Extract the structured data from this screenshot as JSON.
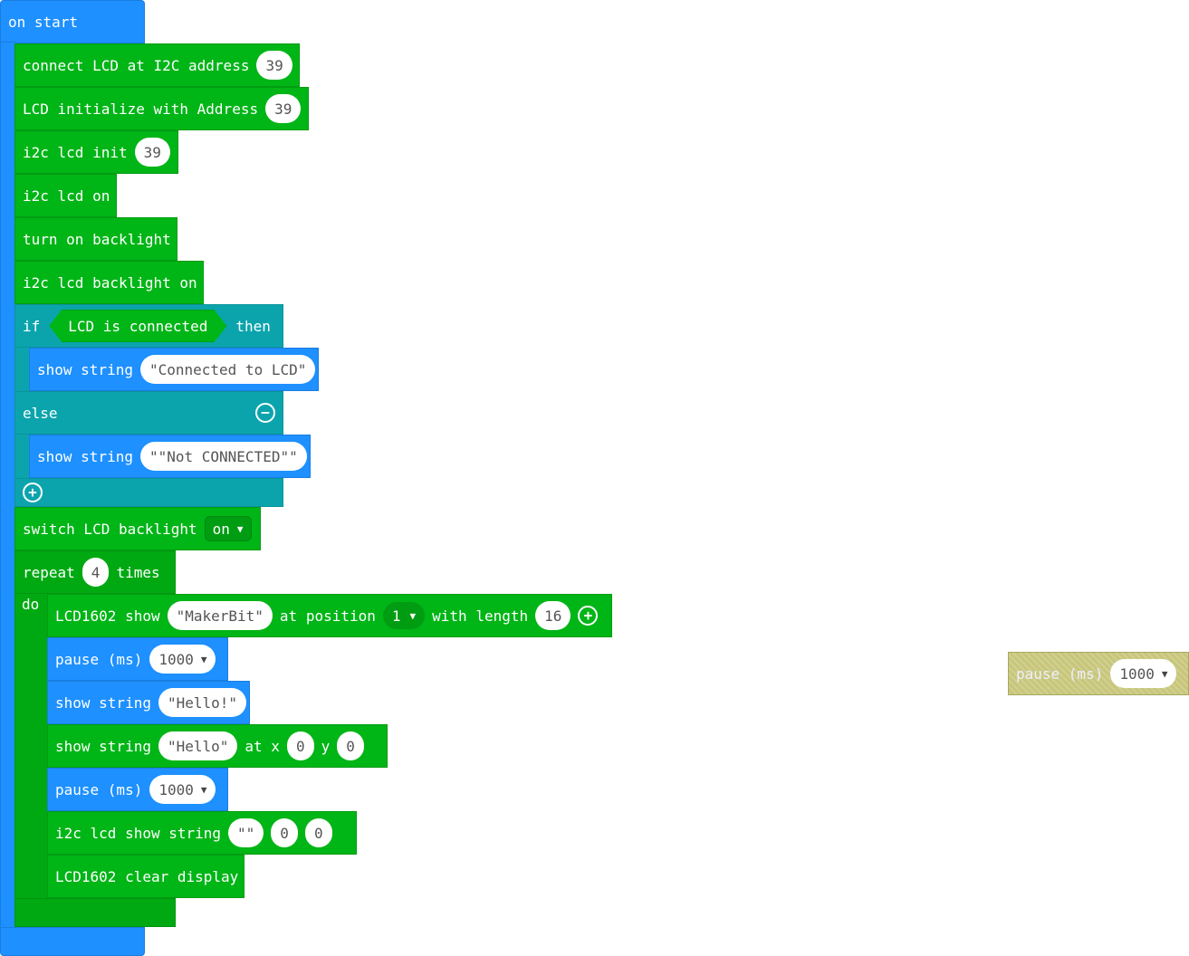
{
  "colors": {
    "event": "#1e90ff",
    "lcd": "#00b516",
    "logic": "#0ba4ad",
    "loop": "#00a912",
    "disabled": "#c7c67a"
  },
  "on_start": {
    "label": "on start"
  },
  "connect_lcd": {
    "label": "connect LCD at I2C address",
    "value": "39"
  },
  "lcd_init": {
    "label": "LCD initialize with Address",
    "value": "39"
  },
  "i2c_init": {
    "label": "i2c lcd init",
    "value": "39"
  },
  "i2c_on": {
    "label": "i2c lcd on"
  },
  "backlight_on": {
    "label": "turn on backlight"
  },
  "i2c_backlight": {
    "label": "i2c lcd backlight on"
  },
  "if_block": {
    "if_label": "if",
    "condition": "LCD is connected",
    "then_label": "then",
    "else_label": "else",
    "remove_icon": "minus-circle-icon",
    "add_icon": "plus-circle-icon"
  },
  "show_connected": {
    "label": "show string",
    "value": "\"Connected to LCD\""
  },
  "show_not_connected": {
    "label": "show string",
    "value": "\"\"Not CONNECTED\"\""
  },
  "switch_backlight": {
    "label": "switch LCD backlight",
    "option": "on"
  },
  "repeat": {
    "label": "repeat",
    "count": "4",
    "times_label": "times",
    "do_label": "do"
  },
  "lcd1602_show": {
    "label": "LCD1602 show",
    "text": "\"MakerBit\"",
    "position_label": "at position",
    "position": "1",
    "length_label": "with length",
    "length": "16",
    "expand_icon": "plus-circle-icon"
  },
  "pause1": {
    "label": "pause (ms)",
    "value": "1000"
  },
  "show_hello": {
    "label": "show string",
    "value": "\"Hello!\""
  },
  "show_hello_xy": {
    "label": "show string",
    "value": "\"Hello\"",
    "at_x_label": "at x",
    "x": "0",
    "y_label": "y",
    "y": "0"
  },
  "pause2": {
    "label": "pause (ms)",
    "value": "1000"
  },
  "i2c_show": {
    "label": "i2c lcd show string",
    "value": "\"\"",
    "x": "0",
    "y": "0"
  },
  "lcd_clear": {
    "label": "LCD1602 clear display"
  },
  "floating_pause": {
    "label": "pause (ms)",
    "value": "1000"
  }
}
